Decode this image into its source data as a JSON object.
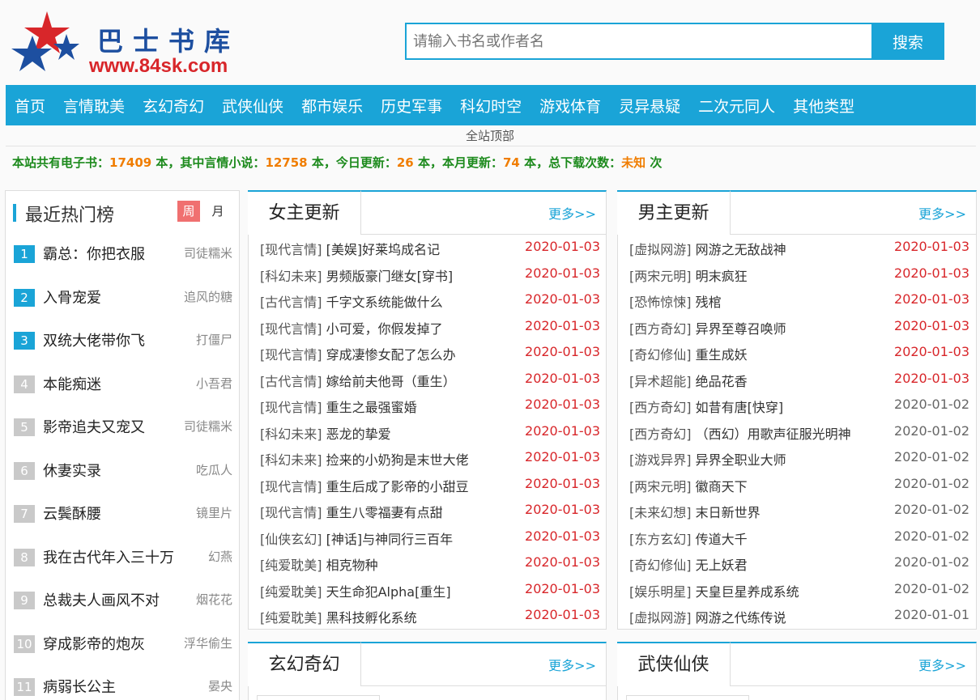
{
  "header": {
    "logo_title": "巴士书库",
    "logo_url": "www.84sk.com",
    "search_placeholder": "请输入书名或作者名",
    "search_button": "搜索"
  },
  "nav": [
    "首页",
    "言情耽美",
    "玄幻奇幻",
    "武侠仙侠",
    "都市娱乐",
    "历史军事",
    "科幻时空",
    "游戏体育",
    "灵异悬疑",
    "二次元同人",
    "其他类型"
  ],
  "subnav": "全站顶部",
  "stats": {
    "p1": "本站共有电子书：",
    "total": "17409",
    "p2": " 本，其中言情小说：",
    "romance": "12758",
    "p3": " 本，今日更新：",
    "today": "26",
    "p4": " 本，本月更新：",
    "month": "74",
    "p5": " 本，总下载次数：",
    "downloads": "未知",
    "p6": " 次"
  },
  "hot": {
    "title": "最近热门榜",
    "week": "周",
    "month": "月",
    "items": [
      {
        "rank": "1",
        "title": "霸总：你把衣服",
        "author": "司徒糯米"
      },
      {
        "rank": "2",
        "title": "入骨宠爱",
        "author": "追风的糖"
      },
      {
        "rank": "3",
        "title": "双统大佬带你飞",
        "author": "打僵尸"
      },
      {
        "rank": "4",
        "title": "本能痴迷",
        "author": "小吾君"
      },
      {
        "rank": "5",
        "title": "影帝追夫又宠又",
        "author": "司徒糯米"
      },
      {
        "rank": "6",
        "title": "休妻实录",
        "author": "吃瓜人"
      },
      {
        "rank": "7",
        "title": "云鬓酥腰",
        "author": "镜里片"
      },
      {
        "rank": "8",
        "title": "我在古代年入三十万",
        "author": "幻燕"
      },
      {
        "rank": "9",
        "title": "总裁夫人画风不对",
        "author": "烟花花"
      },
      {
        "rank": "10",
        "title": "穿成影帝的炮灰",
        "author": "浮华偷生"
      },
      {
        "rank": "11",
        "title": "病弱长公主",
        "author": "晏央"
      }
    ]
  },
  "female": {
    "title": "女主更新",
    "more": "更多>>",
    "items": [
      {
        "cat": "[现代言情]",
        "title": "[美娱]好莱坞成名记",
        "date": "2020-01-03"
      },
      {
        "cat": "[科幻未来]",
        "title": "男频版豪门继女[穿书]",
        "date": "2020-01-03"
      },
      {
        "cat": "[古代言情]",
        "title": "千字文系统能做什么",
        "date": "2020-01-03"
      },
      {
        "cat": "[现代言情]",
        "title": "小可爱，你假发掉了",
        "date": "2020-01-03"
      },
      {
        "cat": "[现代言情]",
        "title": "穿成凄惨女配了怎么办",
        "date": "2020-01-03"
      },
      {
        "cat": "[古代言情]",
        "title": "嫁给前夫他哥（重生）",
        "date": "2020-01-03"
      },
      {
        "cat": "[现代言情]",
        "title": "重生之最强蜜婚",
        "date": "2020-01-03"
      },
      {
        "cat": "[科幻未来]",
        "title": "恶龙的挚爱",
        "date": "2020-01-03"
      },
      {
        "cat": "[科幻未来]",
        "title": "捡来的小奶狗是末世大佬",
        "date": "2020-01-03"
      },
      {
        "cat": "[现代言情]",
        "title": "重生后成了影帝的小甜豆",
        "date": "2020-01-03"
      },
      {
        "cat": "[现代言情]",
        "title": "重生八零福妻有点甜",
        "date": "2020-01-03"
      },
      {
        "cat": "[仙侠玄幻]",
        "title": "[神话]与神同行三百年",
        "date": "2020-01-03"
      },
      {
        "cat": "[纯爱耽美]",
        "title": "相克物种",
        "date": "2020-01-03"
      },
      {
        "cat": "[纯爱耽美]",
        "title": "天生命犯Alpha[重生]",
        "date": "2020-01-03"
      },
      {
        "cat": "[纯爱耽美]",
        "title": "黑科技孵化系统",
        "date": "2020-01-03"
      }
    ]
  },
  "male": {
    "title": "男主更新",
    "more": "更多>>",
    "items": [
      {
        "cat": "[虚拟网游]",
        "title": "网游之无敌战神",
        "date": "2020-01-03",
        "new": true
      },
      {
        "cat": "[两宋元明]",
        "title": "明末疯狂",
        "date": "2020-01-03",
        "new": true
      },
      {
        "cat": "[恐怖惊悚]",
        "title": "残棺",
        "date": "2020-01-03",
        "new": true
      },
      {
        "cat": "[西方奇幻]",
        "title": "异界至尊召唤师",
        "date": "2020-01-03",
        "new": true
      },
      {
        "cat": "[奇幻修仙]",
        "title": "重生成妖",
        "date": "2020-01-03",
        "new": true
      },
      {
        "cat": "[异术超能]",
        "title": "绝品花香",
        "date": "2020-01-03",
        "new": true
      },
      {
        "cat": "[西方奇幻]",
        "title": "如昔有唐[快穿]",
        "date": "2020-01-02",
        "new": false
      },
      {
        "cat": "[西方奇幻]",
        "title": "（西幻）用歌声征服光明神",
        "date": "2020-01-02",
        "new": false
      },
      {
        "cat": "[游戏异界]",
        "title": "异界全职业大师",
        "date": "2020-01-02",
        "new": false
      },
      {
        "cat": "[两宋元明]",
        "title": "徽商天下",
        "date": "2020-01-02",
        "new": false
      },
      {
        "cat": "[未来幻想]",
        "title": "末日新世界",
        "date": "2020-01-02",
        "new": false
      },
      {
        "cat": "[东方玄幻]",
        "title": "传道大千",
        "date": "2020-01-02",
        "new": false
      },
      {
        "cat": "[奇幻修仙]",
        "title": "无上妖君",
        "date": "2020-01-02",
        "new": false
      },
      {
        "cat": "[娱乐明星]",
        "title": "天皇巨星养成系统",
        "date": "2020-01-02",
        "new": false
      },
      {
        "cat": "[虚拟网游]",
        "title": "网游之代练传说",
        "date": "2020-01-01",
        "new": false
      }
    ]
  },
  "fantasy": {
    "title": "玄幻奇幻",
    "more": "更多>>"
  },
  "wuxia": {
    "title": "武侠仙侠",
    "more": "更多>>"
  },
  "colors": {
    "accent": "#1aa4d7",
    "date_new": "#d8262a",
    "stat_green": "#1c8a1c",
    "stat_orange": "#f07d00"
  }
}
